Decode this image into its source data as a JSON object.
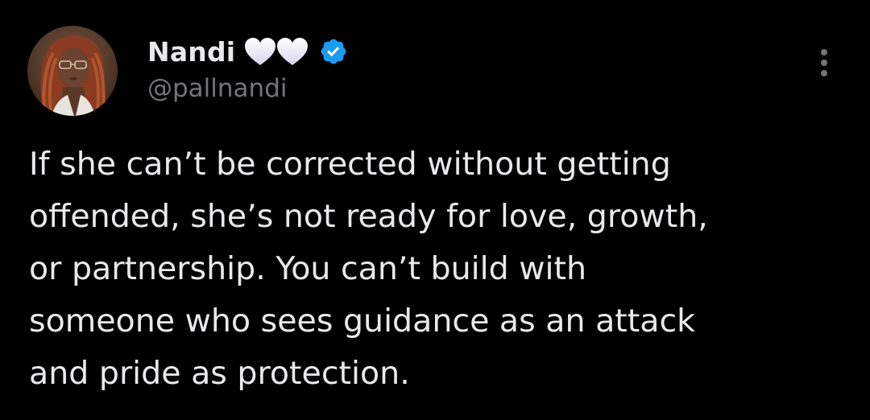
{
  "tweet": {
    "author": {
      "display_name": "Nandi",
      "name_emojis": [
        "white-heart",
        "white-heart"
      ],
      "handle": "@pallnandi",
      "verified": true,
      "verified_color": "#1d9bf0"
    },
    "text_lines": [
      "If she can’t be corrected without getting",
      "offended, she’s not ready for love, growth,",
      "or partnership. You can’t build with",
      "someone who sees guidance as an attack",
      "and pride as protection."
    ],
    "menu_icon": "more-vertical-icon"
  },
  "colors": {
    "background": "#000000",
    "primary_text": "#e7e9ea",
    "secondary_text": "#71767b"
  }
}
